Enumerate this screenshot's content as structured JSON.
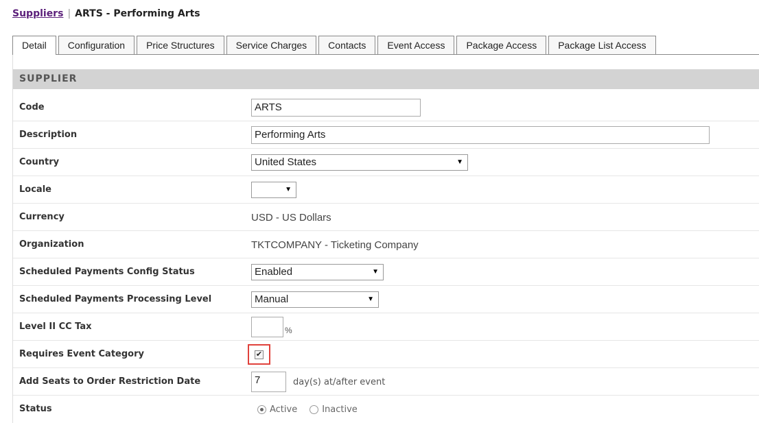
{
  "breadcrumb": {
    "link": "Suppliers",
    "separator": "|",
    "current": "ARTS - Performing Arts"
  },
  "tabs": [
    {
      "label": "Detail",
      "active": true
    },
    {
      "label": "Configuration",
      "active": false
    },
    {
      "label": "Price Structures",
      "active": false
    },
    {
      "label": "Service Charges",
      "active": false
    },
    {
      "label": "Contacts",
      "active": false
    },
    {
      "label": "Event Access",
      "active": false
    },
    {
      "label": "Package Access",
      "active": false
    },
    {
      "label": "Package List Access",
      "active": false
    }
  ],
  "section": {
    "title": "SUPPLIER"
  },
  "fields": {
    "code": {
      "label": "Code",
      "value": "ARTS"
    },
    "description": {
      "label": "Description",
      "value": "Performing Arts"
    },
    "country": {
      "label": "Country",
      "value": "United States"
    },
    "locale": {
      "label": "Locale",
      "value": ""
    },
    "currency": {
      "label": "Currency",
      "value": "USD - US Dollars"
    },
    "organization": {
      "label": "Organization",
      "value": "TKTCOMPANY - Ticketing Company"
    },
    "sched_config": {
      "label": "Scheduled Payments Config Status",
      "value": "Enabled"
    },
    "sched_level": {
      "label": "Scheduled Payments Processing Level",
      "value": "Manual"
    },
    "cc_tax": {
      "label": "Level II CC Tax",
      "value": "",
      "suffix": "%"
    },
    "event_category": {
      "label": "Requires Event Category",
      "checked": true,
      "check_glyph": "✔"
    },
    "restriction": {
      "label": "Add Seats to Order Restriction Date",
      "value": "7",
      "suffix": "day(s) at/after event"
    },
    "status": {
      "label": "Status",
      "options": [
        "Active",
        "Inactive"
      ],
      "selected": "Active"
    }
  },
  "icons": {
    "dropdown": "▼"
  },
  "colors": {
    "link": "#5b1f7a",
    "highlight": "#e0413b",
    "header_bg": "#d3d3d3"
  }
}
